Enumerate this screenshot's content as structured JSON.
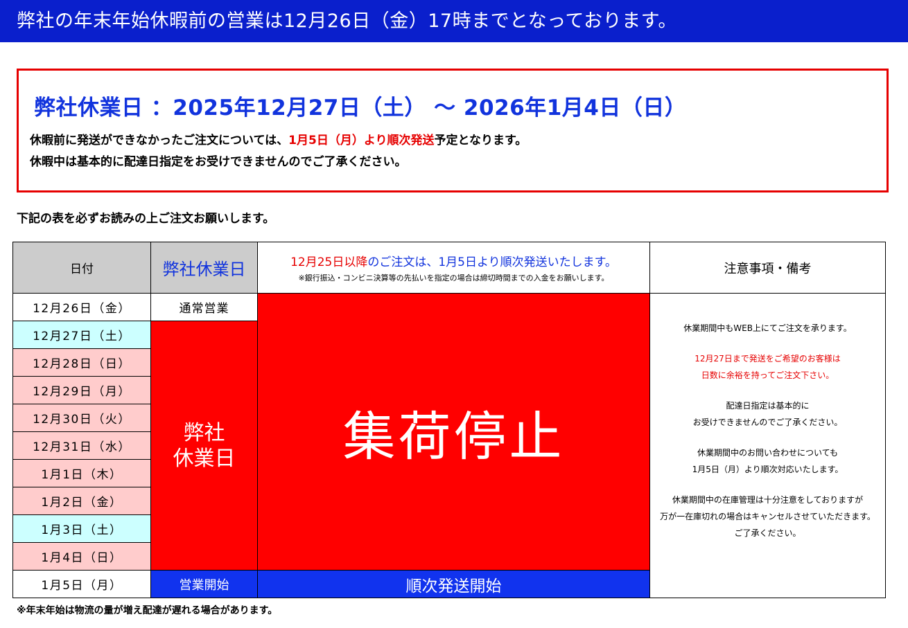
{
  "banner": "弊社の年末年始休暇前の営業は12月26日（金）17時までとなっております。",
  "notice": {
    "title": "弊社休業日 ：2025年12月27日（土） ～ 2026年1月4日（日）",
    "line1_pre": "休暇前に発送ができなかったご注文については、",
    "line1_red": "1月5日（月）より順次発送",
    "line1_post": "予定となります。",
    "line2": "休暇中は基本的に配達日指定をお受けできませんのでご了承ください。"
  },
  "intro": "下記の表を必ずお読みの上ご注文お願いします。",
  "table": {
    "header": {
      "date": "日付",
      "holiday": "弊社休業日",
      "msg_red": "12月25日以降",
      "msg_blue": "のご注文は、1月5日より順次発送いたします。",
      "msg_note": "※銀行振込・コンビニ決算等の先払いを指定の場合は締切時間までの入金をお願いします。",
      "notes": "注意事項・備考"
    },
    "dates": [
      "12月26日（金）",
      "12月27日（土）",
      "12月28日（日）",
      "12月29日（月）",
      "12月30日（火）",
      "12月31日（水）",
      "1月1日（木）",
      "1月2日（金）",
      "1月3日（土）",
      "1月4日（日）",
      "1月5日（月）"
    ],
    "normal": "通常営業",
    "holiday_line1": "弊社",
    "holiday_line2": "休業日",
    "stop": "集荷停止",
    "open": "営業開始",
    "ship": "順次発送開始",
    "notes": {
      "n1": "休業期間中もWEB上にてご注文を承ります。",
      "n2": "12月27日まで発送をご希望のお客様は",
      "n3": "日数に余裕を持ってご注文下さい。",
      "n4": "配達日指定は基本的に",
      "n5": "お受けできませんのでご了承ください。",
      "n6": "休業期間中のお問い合わせについても",
      "n7": "1月5日（月）より順次対応いたします。",
      "n8": "休業期間中の在庫管理は十分注意をしておりますが",
      "n9": "万が一在庫切れの場合はキャンセルさせていただきます。",
      "n10": "ご了承ください。"
    }
  },
  "footer": "※年末年始は物流の量が増え配達が遅れる場合があります。",
  "colors": {
    "banner_blue": "#0a1fcc",
    "alert_red": "#ff0000",
    "text_blue": "#1133dd",
    "weekend_cyan": "#ccffff",
    "holiday_pink": "#ffcccc",
    "header_gray": "#cccccc"
  }
}
